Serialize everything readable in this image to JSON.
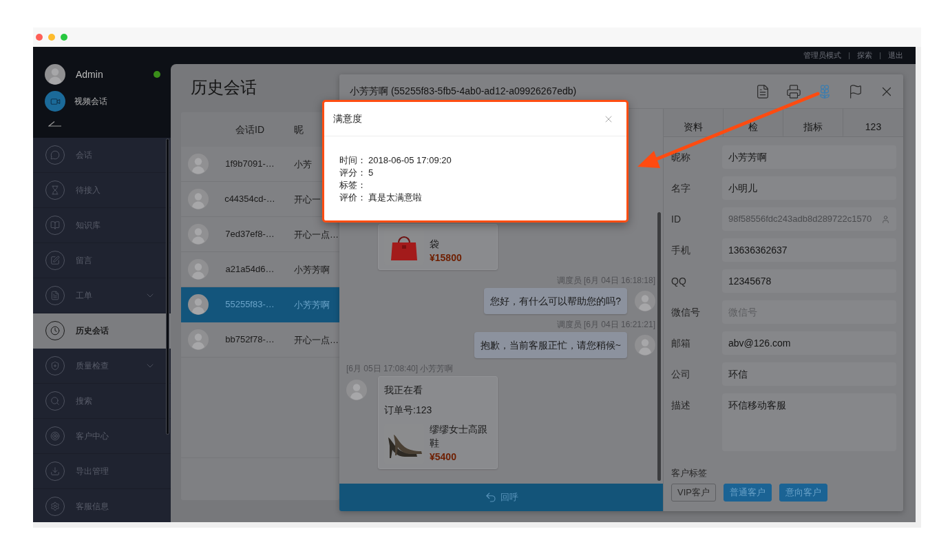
{
  "top_bar": {
    "items": [
      {
        "kind": "link",
        "text": "管理员模式"
      },
      {
        "kind": "separator",
        "text": "|"
      },
      {
        "kind": "link",
        "text": "探索"
      },
      {
        "kind": "separator",
        "text": "|"
      },
      {
        "kind": "link",
        "text": "退出"
      }
    ]
  },
  "sidebar": {
    "user": {
      "name": "Admin",
      "online": true
    },
    "video_chat": {
      "label": "视频会话"
    },
    "items": [
      {
        "label": "会话",
        "selected": false,
        "has_submenu": false
      },
      {
        "label": "待接入",
        "selected": false,
        "has_submenu": false
      },
      {
        "label": "知识库",
        "selected": false,
        "has_submenu": false
      },
      {
        "label": "留言",
        "selected": false,
        "has_submenu": false
      },
      {
        "label": "工单",
        "selected": false,
        "has_submenu": true
      },
      {
        "label": "历史会话",
        "selected": true,
        "has_submenu": false
      },
      {
        "label": "质量检查",
        "selected": false,
        "has_submenu": true
      },
      {
        "label": "搜索",
        "selected": false,
        "has_submenu": false
      },
      {
        "label": "客户中心",
        "selected": false,
        "has_submenu": false
      },
      {
        "label": "导出管理",
        "selected": false,
        "has_submenu": false
      },
      {
        "label": "客服信息",
        "selected": false,
        "has_submenu": false
      }
    ]
  },
  "page_title": "历史会话",
  "session_list": {
    "columns": [
      "会话ID",
      "昵"
    ],
    "rows": [
      {
        "session_id": "1f9b7091-…",
        "nickname": "小芳",
        "selected": false
      },
      {
        "session_id": "c44354cd-…",
        "nickname": "开心一",
        "selected": false
      },
      {
        "session_id": "7ed37ef8-…",
        "nickname": "开心一点…",
        "selected": false
      },
      {
        "session_id": "a21a54d6…",
        "nickname": "小芳芳啊",
        "selected": false
      },
      {
        "session_id": "55255f83-…",
        "nickname": "小芳芳啊",
        "selected": true
      },
      {
        "session_id": "bb752f78-…",
        "nickname": "开心一点…",
        "selected": false
      }
    ]
  },
  "chat_window": {
    "title": "小芳芳啊 (55255f83-5fb5-4ab0-ad12-a09926267edb)",
    "toolbar": [
      {
        "active": false
      },
      {
        "active": false
      },
      {
        "active": true
      },
      {
        "active": false
      }
    ],
    "messages": [
      {
        "kind": "product",
        "outgoing": false,
        "product": {
          "name": "袋",
          "price": "¥15800"
        }
      },
      {
        "kind": "text",
        "outgoing": true,
        "meta": "调度员 [6月 04日 16:18:18]",
        "text": "您好，有什么可以帮助您的吗?"
      },
      {
        "kind": "text",
        "outgoing": true,
        "meta": "调度员 [6月 04日 16:21:21]",
        "text": "抱歉，当前客服正忙，请您稍候~"
      },
      {
        "kind": "card",
        "outgoing": false,
        "meta": "[6月 05日 17:08:40] 小芳芳啊",
        "lines": [
          "我正在看",
          "订单号:123"
        ],
        "product": {
          "name": "缪缪女士高跟鞋",
          "price": "¥5400"
        }
      }
    ],
    "callback_button": {
      "label": "回呼"
    }
  },
  "customer_panel": {
    "tabs": [
      "资料",
      "检",
      "指标",
      "123"
    ],
    "fields": [
      {
        "label": "昵称",
        "kind": "input",
        "value": "小芳芳啊",
        "disabled": false
      },
      {
        "label": "名字",
        "kind": "input",
        "value": "小明儿",
        "disabled": false
      },
      {
        "label": "ID",
        "kind": "input",
        "value": "98f58556fdc243adb8d289722c1570",
        "disabled": true
      },
      {
        "label": "手机",
        "kind": "input",
        "value": "13636362637",
        "disabled": false
      },
      {
        "label": "QQ",
        "kind": "input",
        "value": "12345678",
        "disabled": false
      },
      {
        "label": "微信号",
        "kind": "input",
        "placeholder": "微信号",
        "disabled": false
      },
      {
        "label": "邮箱",
        "kind": "input",
        "value": "abv@126.com",
        "disabled": false
      },
      {
        "label": "公司",
        "kind": "input",
        "value": "环信",
        "disabled": false
      },
      {
        "label": "描述",
        "kind": "textarea",
        "value": "环信移动客服",
        "disabled": false
      }
    ],
    "tags_label": "客户标签",
    "tags": [
      {
        "label": "VIP客户",
        "selected": false
      },
      {
        "label": "普通客户",
        "selected": true
      },
      {
        "label": "意向客户",
        "selected": true
      }
    ]
  },
  "satisfaction_dialog": {
    "title": "满意度",
    "rows": [
      {
        "label": "时间：",
        "value": "2018-06-05 17:09:20"
      },
      {
        "label": "评分：",
        "value": "5"
      },
      {
        "label": "标签："
      },
      {
        "label": "评价：",
        "value": "真是太满意啦"
      }
    ]
  }
}
